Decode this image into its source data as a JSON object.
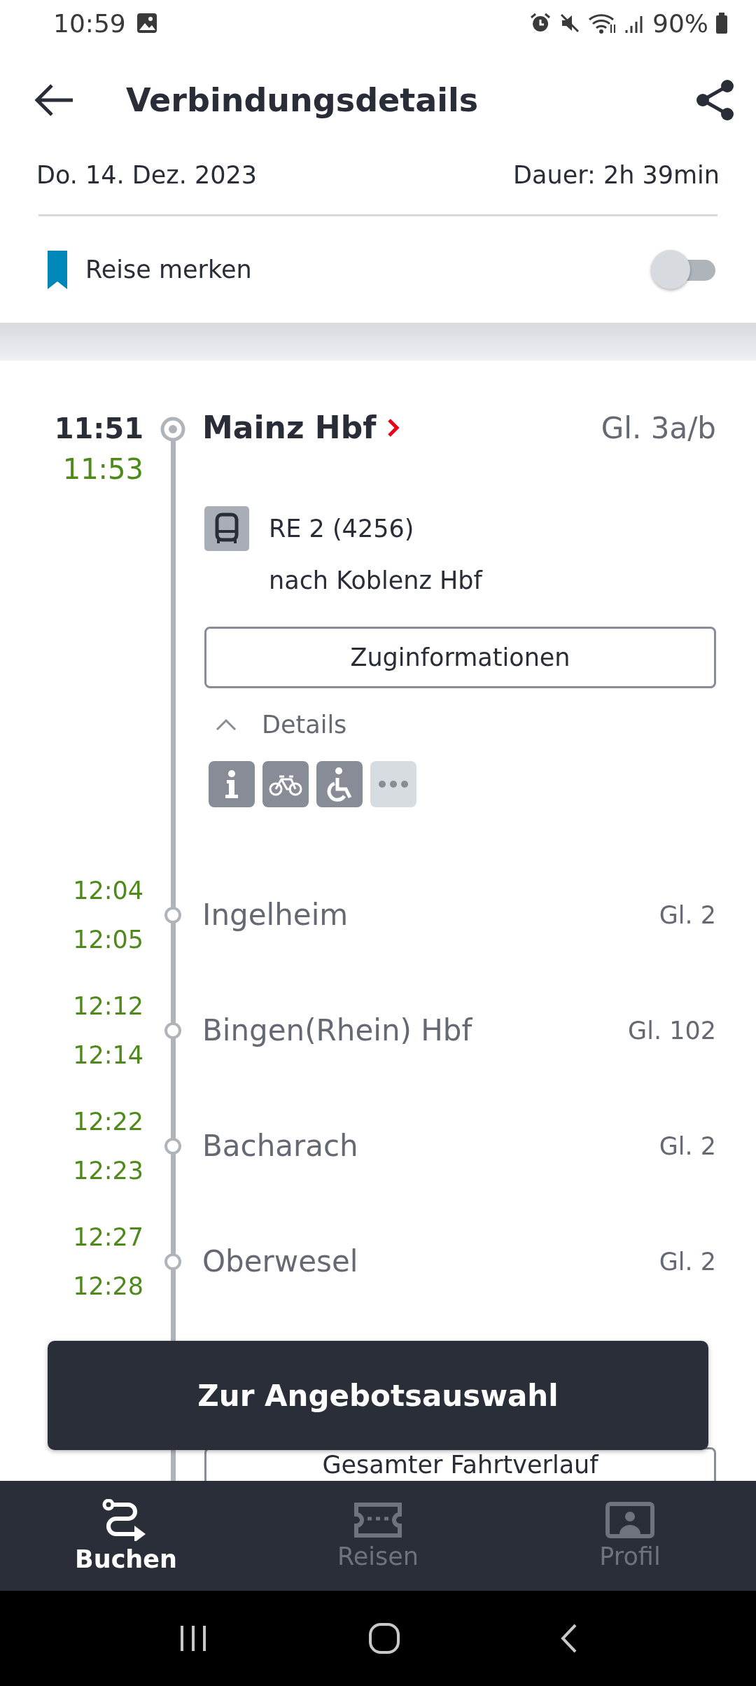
{
  "status_bar": {
    "time": "10:59",
    "battery": "90%"
  },
  "header": {
    "title": "Verbindungsdetails",
    "date": "Do. 14. Dez. 2023",
    "duration": "Dauer: 2h 39min"
  },
  "bookmark": {
    "label": "Reise merken",
    "on": false
  },
  "departure": {
    "planned_time": "11:51",
    "actual_time": "11:53",
    "station": "Mainz Hbf",
    "platform": "Gl. 3a/b"
  },
  "train": {
    "name": "RE 2 (4256)",
    "direction": "nach Koblenz Hbf"
  },
  "info_button": "Zuginformationen",
  "details": {
    "label": "Details",
    "expanded": true
  },
  "attributes": [
    {
      "kind": "info"
    },
    {
      "kind": "bike"
    },
    {
      "kind": "wheelchair"
    },
    {
      "kind": "more"
    }
  ],
  "stops": [
    {
      "arrival": "12:04",
      "departure": "12:05",
      "name": "Ingelheim",
      "platform": "Gl. 2"
    },
    {
      "arrival": "12:12",
      "departure": "12:14",
      "name": "Bingen(Rhein) Hbf",
      "platform": "Gl. 102"
    },
    {
      "arrival": "12:22",
      "departure": "12:23",
      "name": "Bacharach",
      "platform": "Gl. 2"
    },
    {
      "arrival": "12:27",
      "departure": "12:28",
      "name": "Oberwesel",
      "platform": "Gl. 2"
    }
  ],
  "full_route_button": "Gesamter Fahrtverlauf",
  "cta_button": "Zur Angebotsauswahl",
  "nav": [
    {
      "kind": "route",
      "label": "Buchen",
      "selected": true
    },
    {
      "kind": "ticket",
      "label": "Reisen",
      "selected": false
    },
    {
      "kind": "profile",
      "label": "Profil",
      "selected": false
    }
  ]
}
